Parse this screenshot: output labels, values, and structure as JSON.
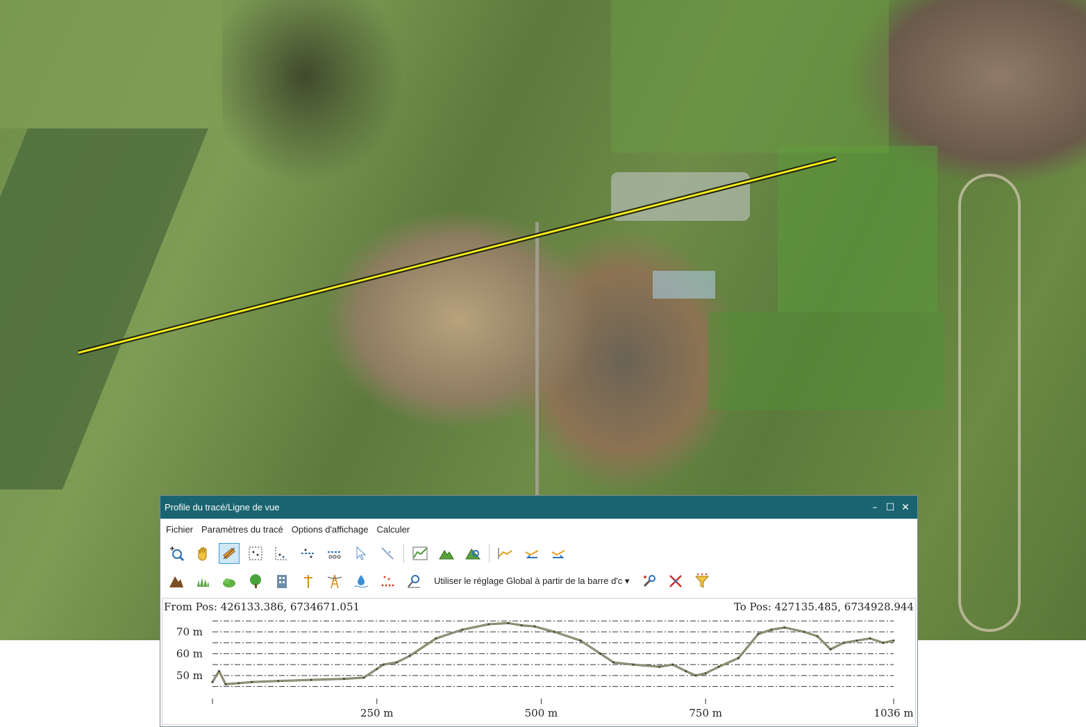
{
  "window": {
    "title": "Profile du tracé/Ligne de vue",
    "minimize": "–",
    "maximize": "☐",
    "close": "✕"
  },
  "menu": [
    "Fichier",
    "Paramètres du tracé",
    "Options d'affichage",
    "Calculer"
  ],
  "toolbar1": [
    "zoom-icon",
    "pan-hand-icon",
    "draw-profile-icon",
    "select-points-icon",
    "select-region-icon",
    "slice-top-icon",
    "slice-bottom-icon",
    "pointer-icon",
    "measure-icon",
    "profile-graph-icon",
    "terrain-icon",
    "terrain-tool-icon",
    "profile-line-icon",
    "profile-left-icon",
    "profile-right-icon"
  ],
  "toolbar2": {
    "icons": [
      "mountain-icon",
      "grass-icon",
      "bush-icon",
      "tree-icon",
      "building-icon",
      "pole-icon",
      "power-line-icon",
      "water-icon",
      "noise-points-icon",
      "pin-icon"
    ],
    "layer_select": "Utiliser le réglage Global à partir de la barre d'c",
    "extra_icons": [
      "tools-icon",
      "clear-icon",
      "filter-icon"
    ]
  },
  "profile": {
    "from_label": "From Pos: 426133.386, 6734671.051",
    "to_label": "To Pos: 427135.485, 6734928.944"
  },
  "colors": {
    "titlebar": "#196470",
    "profile_line": "#f1ec1a"
  },
  "chart_data": {
    "type": "line",
    "title": "",
    "xlabel": "",
    "ylabel": "",
    "xlim": [
      0,
      1036
    ],
    "ylim": [
      42,
      77
    ],
    "x_ticks": [
      250,
      500,
      750,
      1036
    ],
    "x_tick_labels": [
      "250 m",
      "500 m",
      "750 m",
      "1036 m"
    ],
    "y_ticks": [
      50,
      60,
      70
    ],
    "y_tick_labels": [
      "50 m",
      "60 m",
      "70 m"
    ],
    "grid": "horizontal-dashed",
    "series": [
      {
        "x": [
          0,
          10,
          20,
          40,
          60,
          100,
          150,
          200,
          230,
          250,
          260,
          280,
          300,
          340,
          380,
          420,
          450,
          470,
          490,
          520,
          560,
          590,
          610,
          640,
          680,
          700,
          720,
          735,
          750,
          770,
          800,
          830,
          850,
          870,
          900,
          920,
          940,
          960,
          980,
          1000,
          1020,
          1036
        ],
        "y": [
          47,
          52,
          46,
          46.5,
          47,
          47.5,
          48,
          48.5,
          49,
          53,
          55,
          56,
          59,
          67,
          71,
          73.5,
          74,
          73,
          72.5,
          70,
          66,
          60,
          56,
          55,
          54,
          55,
          52,
          50,
          51,
          54,
          58,
          69,
          71,
          72,
          70,
          68,
          62,
          65,
          66,
          67,
          65,
          66
        ]
      }
    ]
  }
}
